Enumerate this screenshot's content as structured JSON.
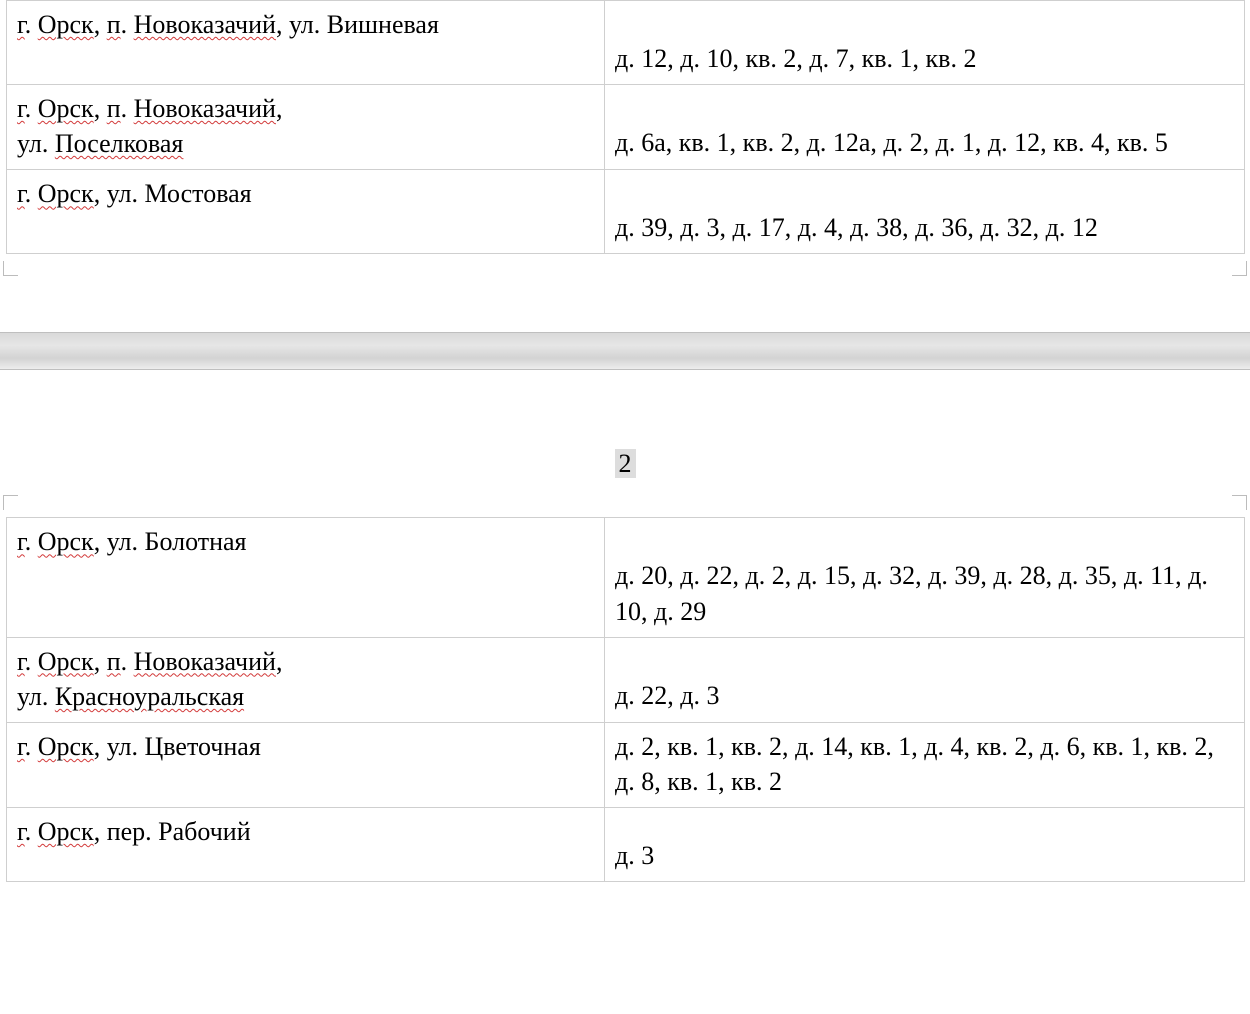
{
  "page1": {
    "rows": [
      {
        "addr_parts": [
          {
            "t": "г",
            "sp": true
          },
          {
            "t": ". "
          },
          {
            "t": "Орск",
            "sp": true
          },
          {
            "t": ", "
          },
          {
            "t": "п",
            "sp": true
          },
          {
            "t": ". "
          },
          {
            "t": "Новоказачий",
            "sp": true
          },
          {
            "t": ", ул. Вишневая"
          }
        ],
        "detail_lead_gap": true,
        "detail_parts": [
          {
            "t": "д",
            "sp": true
          },
          {
            "t": ". 12, "
          },
          {
            "t": "д",
            "sp": true
          },
          {
            "t": ". 10, кв. 2, "
          },
          {
            "t": "д",
            "sp": true
          },
          {
            "t": ". 7, кв. 1, кв. 2"
          }
        ]
      },
      {
        "addr_parts": [
          {
            "t": "г",
            "sp": true
          },
          {
            "t": ". "
          },
          {
            "t": "Орск",
            "sp": true
          },
          {
            "t": ", "
          },
          {
            "t": "п",
            "sp": true
          },
          {
            "t": ". "
          },
          {
            "t": "Новоказачий",
            "sp": true
          },
          {
            "t": ",",
            "br": true
          },
          {
            "t": "ул. "
          },
          {
            "t": "Поселковая",
            "sp": true
          }
        ],
        "detail_lead_gap": true,
        "detail_parts": [
          {
            "t": "д",
            "sp": true
          },
          {
            "t": ". 6а, кв. 1, кв. 2, "
          },
          {
            "t": "д",
            "sp": true
          },
          {
            "t": ". 12а, "
          },
          {
            "t": "д",
            "sp": true
          },
          {
            "t": ". 2, "
          },
          {
            "t": "д",
            "sp": true
          },
          {
            "t": ". 1, "
          },
          {
            "t": "д",
            "sp": true
          },
          {
            "t": ". 12, кв. 4, кв. 5"
          }
        ]
      },
      {
        "addr_parts": [
          {
            "t": "г",
            "sp": true
          },
          {
            "t": ". "
          },
          {
            "t": "Орск",
            "sp": true
          },
          {
            "t": ", ул. Мостовая"
          }
        ],
        "detail_lead_gap": true,
        "detail_parts": [
          {
            "t": "д",
            "sp": true
          },
          {
            "t": ". 39, "
          },
          {
            "t": "д",
            "sp": true
          },
          {
            "t": ". 3, "
          },
          {
            "t": "д",
            "sp": true
          },
          {
            "t": ". 17, "
          },
          {
            "t": "д",
            "sp": true
          },
          {
            "t": ". 4, "
          },
          {
            "t": "д",
            "sp": true
          },
          {
            "t": ". 38, "
          },
          {
            "t": "д",
            "sp": true
          },
          {
            "t": ". 36, "
          },
          {
            "t": "д",
            "sp": true
          },
          {
            "t": ". 32, "
          },
          {
            "t": "д",
            "sp": true
          },
          {
            "t": ". 12"
          }
        ]
      }
    ]
  },
  "page_number": "2",
  "page2": {
    "rows": [
      {
        "addr_parts": [
          {
            "t": "г",
            "sp": true
          },
          {
            "t": ". "
          },
          {
            "t": "Орск",
            "sp": true
          },
          {
            "t": ", ул. Болотная"
          }
        ],
        "detail_lead_gap": true,
        "detail_parts": [
          {
            "t": "д",
            "sp": true
          },
          {
            "t": ". 20, "
          },
          {
            "t": "д",
            "sp": true
          },
          {
            "t": ". 22, "
          },
          {
            "t": "д",
            "sp": true
          },
          {
            "t": ". 2, "
          },
          {
            "t": "д",
            "sp": true
          },
          {
            "t": ". 15, "
          },
          {
            "t": "д",
            "sp": true
          },
          {
            "t": ". 32, "
          },
          {
            "t": "д",
            "sp": true
          },
          {
            "t": ". 39, "
          },
          {
            "t": "д",
            "sp": true
          },
          {
            "t": ". 28, "
          },
          {
            "t": "д",
            "sp": true
          },
          {
            "t": ". 35, "
          },
          {
            "t": "д",
            "sp": true
          },
          {
            "t": ". 11, "
          },
          {
            "t": "д",
            "sp": true
          },
          {
            "t": ". 10, "
          },
          {
            "t": "д",
            "sp": true
          },
          {
            "t": ". 29"
          }
        ]
      },
      {
        "addr_parts": [
          {
            "t": "г",
            "sp": true
          },
          {
            "t": ". "
          },
          {
            "t": "Орск",
            "sp": true
          },
          {
            "t": ", "
          },
          {
            "t": "п",
            "sp": true
          },
          {
            "t": ". "
          },
          {
            "t": "Новоказачий",
            "sp": true
          },
          {
            "t": ",",
            "br": true
          },
          {
            "t": "ул. "
          },
          {
            "t": "Красноуральская",
            "sp": true
          }
        ],
        "detail_lead_gap": true,
        "detail_parts": [
          {
            "t": "д",
            "sp": true
          },
          {
            "t": ". 22, "
          },
          {
            "t": "д",
            "sp": true
          },
          {
            "t": ". 3"
          }
        ]
      },
      {
        "addr_parts": [
          {
            "t": "г",
            "sp": true
          },
          {
            "t": ". "
          },
          {
            "t": "Орск",
            "sp": true
          },
          {
            "t": ", ул. Цветочная"
          }
        ],
        "detail_lead_gap": false,
        "detail_parts": [
          {
            "t": "д",
            "sp": true
          },
          {
            "t": ". 2, кв. 1, кв. 2,  "
          },
          {
            "t": "д",
            "sp": true
          },
          {
            "t": ". 14, кв. 1, "
          },
          {
            "t": "д",
            "sp": true
          },
          {
            "t": ". 4, кв. 2, "
          },
          {
            "t": "д",
            "sp": true
          },
          {
            "t": ". 6, кв. 1, кв. 2, "
          },
          {
            "t": "д",
            "sp": true
          },
          {
            "t": ". 8, кв. 1, кв. 2"
          }
        ]
      },
      {
        "addr_parts": [
          {
            "t": "г",
            "sp": true
          },
          {
            "t": ". "
          },
          {
            "t": "Орск",
            "sp": true
          },
          {
            "t": ", пер. Рабочий"
          }
        ],
        "detail_lead_gap_small": true,
        "detail_parts": [
          {
            "t": "д",
            "sp": true
          },
          {
            "t": ". 3"
          }
        ]
      }
    ]
  }
}
